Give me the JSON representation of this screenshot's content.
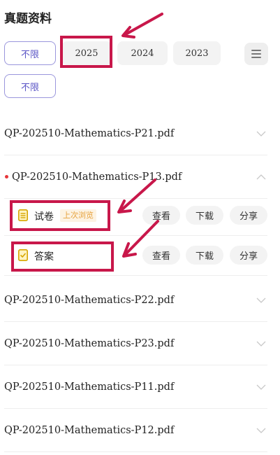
{
  "header": {
    "title": "真题资料"
  },
  "filters": {
    "row1": [
      "不限",
      "2025",
      "2024",
      "2023"
    ],
    "row2": [
      "不限"
    ]
  },
  "files": [
    {
      "name": "QP-202510-Mathematics-P21.pdf"
    },
    {
      "name": "QP-202510-Mathematics-P13.pdf",
      "expanded": true
    },
    {
      "name": "QP-202510-Mathematics-P22.pdf"
    },
    {
      "name": "QP-202510-Mathematics-P23.pdf"
    },
    {
      "name": "QP-202510-Mathematics-P11.pdf"
    },
    {
      "name": "QP-202510-Mathematics-P12.pdf"
    }
  ],
  "expanded_items": [
    {
      "label": "试卷",
      "badge": "上次浏览",
      "icon": "document-icon",
      "icon_color": "#e3b100"
    },
    {
      "label": "答案",
      "icon": "answer-icon",
      "icon_color": "#e3b100"
    }
  ],
  "actions": {
    "view": "查看",
    "download": "下载",
    "share": "分享"
  },
  "colors": {
    "accent": "#5b55c6",
    "annotation": "#c8174a",
    "active_dot": "#e6353a"
  }
}
